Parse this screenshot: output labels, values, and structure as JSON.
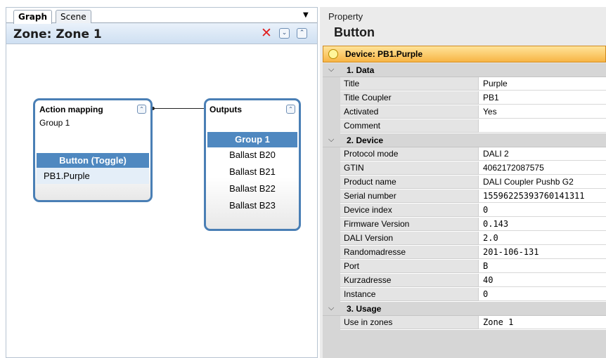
{
  "left": {
    "tabs": [
      {
        "label": "Graph"
      },
      {
        "label": "Scene"
      }
    ],
    "zone_title": "Zone: Zone 1",
    "close_glyph": "✕",
    "expand_icon": "expand-all-icon",
    "collapse_icon": "collapse-all-icon",
    "action_node": {
      "title": "Action mapping",
      "subtitle": "Group 1",
      "selected": "Button (Toggle)",
      "item": "PB1.Purple"
    },
    "outputs_node": {
      "title": "Outputs",
      "items": [
        "Group 1",
        "Ballast B20",
        "Ballast B21",
        "Ballast B22",
        "Ballast B23"
      ]
    }
  },
  "right": {
    "label": "Property",
    "title": "Button",
    "device": "Device: PB1.Purple",
    "sections": [
      {
        "label": "1. Data",
        "rows": [
          {
            "name": "Title",
            "value": "Purple"
          },
          {
            "name": "Title Coupler",
            "value": "PB1"
          },
          {
            "name": "Activated",
            "value": "Yes"
          },
          {
            "name": "Comment",
            "value": ""
          }
        ]
      },
      {
        "label": "2. Device",
        "rows": [
          {
            "name": "Protocol mode",
            "value": "DALI 2"
          },
          {
            "name": "GTIN",
            "value": "4062172087575"
          },
          {
            "name": "Product name",
            "value": "DALI Coupler Pushb G2"
          },
          {
            "name": "Serial number",
            "value": "15596225393760141311"
          },
          {
            "name": "Device index",
            "value": "0"
          },
          {
            "name": "Firmware Version",
            "value": "0.143"
          },
          {
            "name": "DALI Version",
            "value": "2.0"
          },
          {
            "name": "Randomadresse",
            "value": "201-106-131"
          },
          {
            "name": "Port",
            "value": "B"
          },
          {
            "name": "Kurzadresse",
            "value": "40"
          },
          {
            "name": "Instance",
            "value": "0"
          }
        ]
      },
      {
        "label": "3. Usage",
        "rows": [
          {
            "name": "Use in zones",
            "value": "Zone 1"
          }
        ]
      }
    ]
  },
  "colors": {
    "accent": "#4f88c0",
    "node_border": "#4a7fb5",
    "device_bar": "#f7b545",
    "close_red": "#e02020"
  }
}
